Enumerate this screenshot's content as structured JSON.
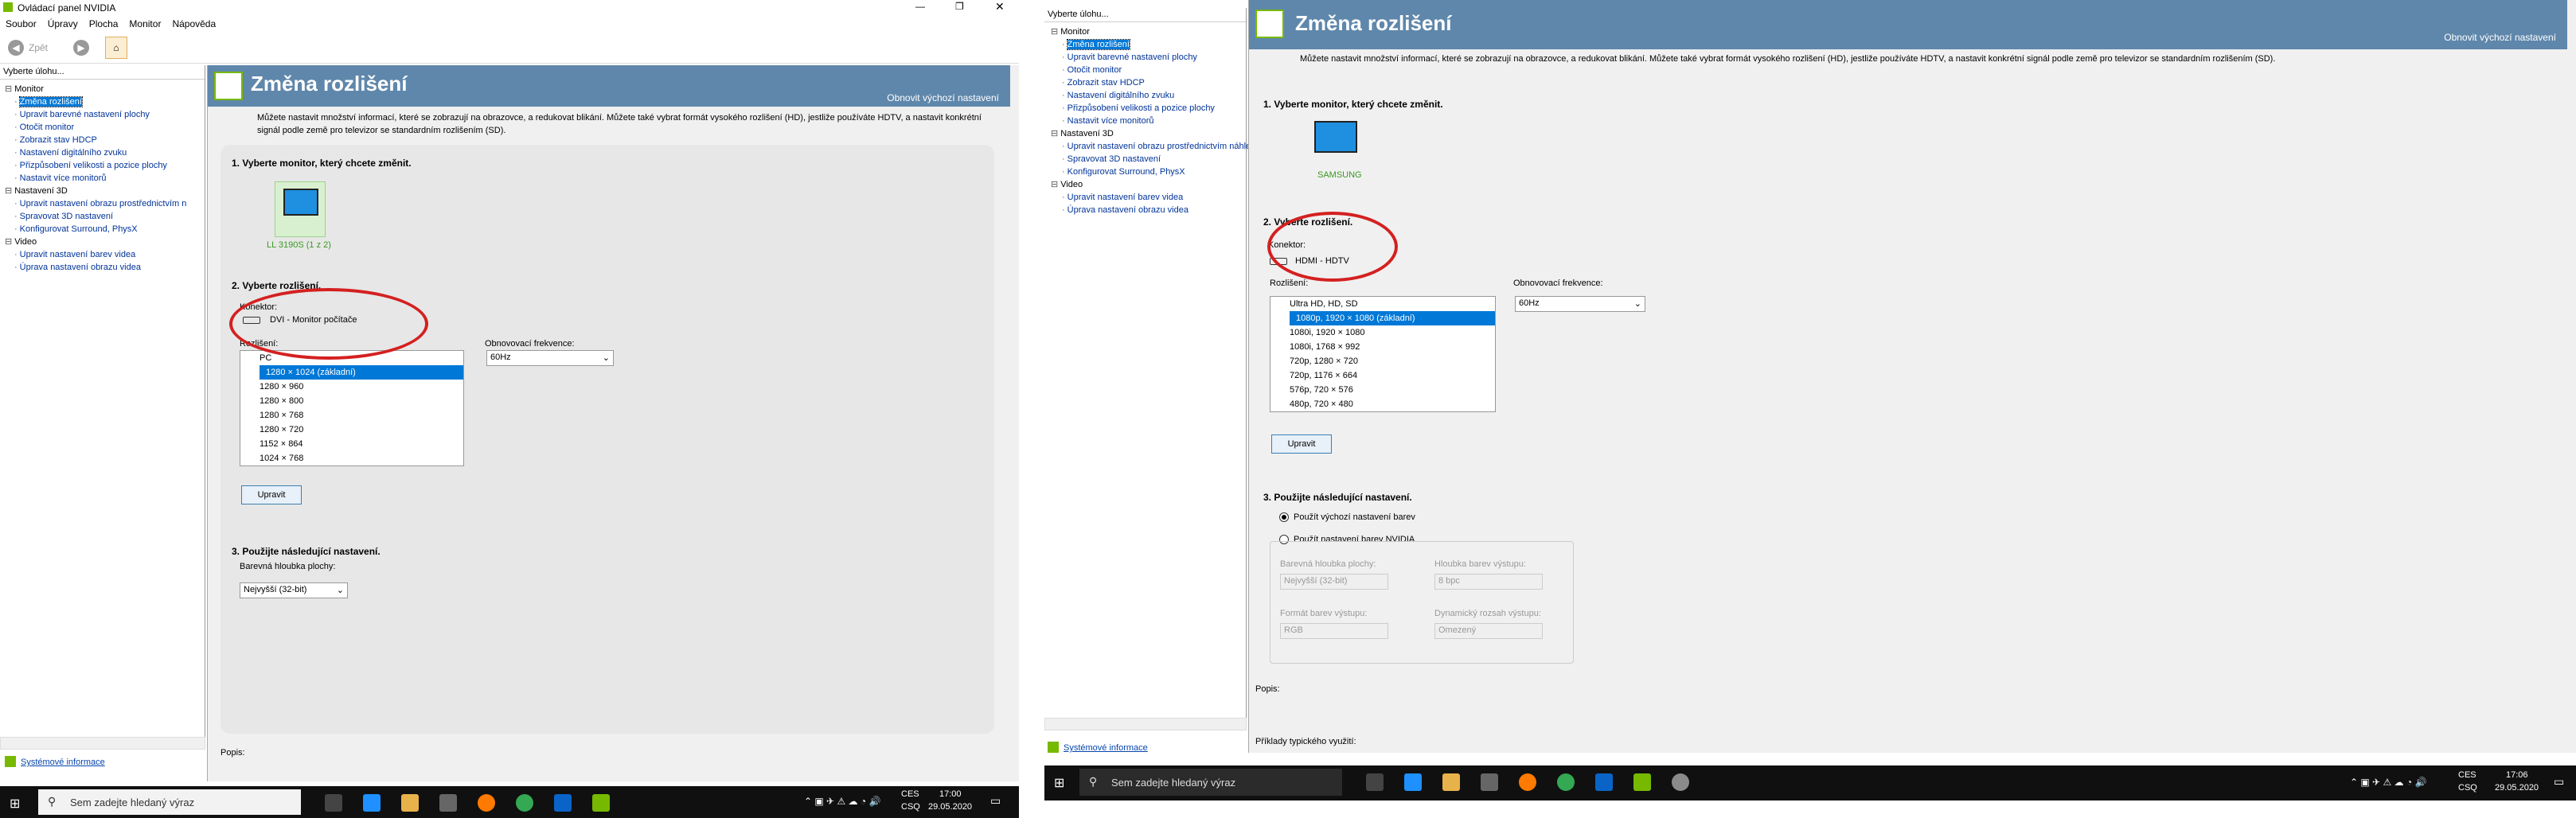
{
  "left": {
    "window_title": "Ovládací panel NVIDIA",
    "menu": [
      "Soubor",
      "Úpravy",
      "Plocha",
      "Monitor",
      "Nápověda"
    ],
    "back_label": "Zpět",
    "tree_head": "Vyberte úlohu...",
    "tree": [
      {
        "text": "Monitor",
        "level": 0
      },
      {
        "text": "Změna rozlišení",
        "level": 1,
        "selected": true
      },
      {
        "text": "Upravit barevné nastavení plochy",
        "level": 1
      },
      {
        "text": "Otočit monitor",
        "level": 1
      },
      {
        "text": "Zobrazit stav HDCP",
        "level": 1
      },
      {
        "text": "Nastavení digitálního zvuku",
        "level": 1
      },
      {
        "text": "Přizpůsobení velikosti a pozice plochy",
        "level": 1
      },
      {
        "text": "Nastavit více monitorů",
        "level": 1
      },
      {
        "text": "Nastavení 3D",
        "level": 0
      },
      {
        "text": "Upravit nastavení obrazu prostřednictvím n",
        "level": 1
      },
      {
        "text": "Spravovat 3D nastavení",
        "level": 1
      },
      {
        "text": "Konfigurovat Surround, PhysX",
        "level": 1
      },
      {
        "text": "Video",
        "level": 0
      },
      {
        "text": "Upravit nastavení barev videa",
        "level": 1
      },
      {
        "text": "Úprava nastavení obrazu videa",
        "level": 1
      }
    ],
    "page_title": "Změna rozlišení",
    "restore_defaults": "Obnovit výchozí nastavení",
    "description": "Můžete nastavit množství informací, které se zobrazují na obrazovce, a redukovat blikání. Můžete také vybrat formát vysokého rozlišení (HD), jestliže používáte HDTV, a nastavit konkrétní signál podle země pro televizor se standardním rozlišením (SD).",
    "step1": "1. Vyberte monitor, který chcete změnit.",
    "monitor_name": "LL 3190S (1 z 2)",
    "step2": "2. Vyberte rozlišení.",
    "connector_label": "Konektor:",
    "connector_value": "DVI - Monitor počítače",
    "resolution_label": "Rozlišení:",
    "refresh_label": "Obnovovací frekvence:",
    "refresh_value": "60Hz",
    "resolutions": [
      "PC",
      "1280 × 1024 (základní)",
      "1280 × 960",
      "1280 × 800",
      "1280 × 768",
      "1280 × 720",
      "1152 × 864",
      "1024 × 768"
    ],
    "customize_button": "Upravit",
    "step3": "3. Použijte následující nastavení.",
    "depth_label": "Barevná hloubka plochy:",
    "depth_value": "Nejvyšší (32-bit)",
    "popis_label": "Popis:",
    "system_info": "Systémové informace"
  },
  "right": {
    "tree_head": "Vyberte úlohu...",
    "tree": [
      {
        "text": "Monitor",
        "level": 0
      },
      {
        "text": "Změna rozlišení",
        "level": 1,
        "selected": true
      },
      {
        "text": "Upravit barevné nastavení plochy",
        "level": 1
      },
      {
        "text": "Otočit monitor",
        "level": 1
      },
      {
        "text": "Zobrazit stav HDCP",
        "level": 1
      },
      {
        "text": "Nastavení digitálního zvuku",
        "level": 1
      },
      {
        "text": "Přizpůsobení velikosti a pozice plochy",
        "level": 1
      },
      {
        "text": "Nastavit více monitorů",
        "level": 1
      },
      {
        "text": "Nastavení 3D",
        "level": 0
      },
      {
        "text": "Upravit nastavení obrazu prostřednictvím náhledu",
        "level": 1
      },
      {
        "text": "Spravovat 3D nastavení",
        "level": 1
      },
      {
        "text": "Konfigurovat Surround, PhysX",
        "level": 1
      },
      {
        "text": "Video",
        "level": 0
      },
      {
        "text": "Upravit nastavení barev videa",
        "level": 1
      },
      {
        "text": "Úprava nastavení obrazu videa",
        "level": 1
      }
    ],
    "page_title": "Změna rozlišení",
    "restore_defaults": "Obnovit výchozí nastavení",
    "description": "Můžete nastavit množství informací, které se zobrazují na obrazovce, a redukovat blikání. Můžete také vybrat formát vysokého rozlišení (HD), jestliže používáte HDTV, a nastavit konkrétní signál podle země pro televizor se standardním rozlišením (SD).",
    "step1": "1. Vyberte monitor, který chcete změnit.",
    "monitor_name": "SAMSUNG",
    "step2": "2. Vyberte rozlišení.",
    "connector_label": "Konektor:",
    "connector_value": "HDMI - HDTV",
    "resolution_label": "Rozlišení:",
    "refresh_label": "Obnovovací frekvence:",
    "refresh_value": "60Hz",
    "resolutions": [
      "Ultra HD, HD, SD",
      "1080p, 1920 × 1080 (základní)",
      "1080i, 1920 × 1080",
      "1080i, 1768 × 992",
      "720p, 1280 × 720",
      "720p, 1176 × 664",
      "576p, 720 × 576",
      "480p, 720 × 480"
    ],
    "customize_button": "Upravit",
    "step3": "3. Použijte následující nastavení.",
    "radio_default": "Použít výchozí nastavení barev",
    "radio_nvidia": "Použít nastavení barev NVIDIA",
    "desktop_depth_label": "Barevná hloubka plochy:",
    "desktop_depth_value": "Nejvyšší (32-bit)",
    "output_depth_label": "Hloubka barev výstupu:",
    "output_depth_value": "8 bpc",
    "output_format_label": "Formát barev výstupu:",
    "output_format_value": "RGB",
    "dynamic_range_label": "Dynamický rozsah výstupu:",
    "dynamic_range_value": "Omezený",
    "popis_label": "Popis:",
    "typical_label": "Příklady typického využití:",
    "system_info": "Systémové informace"
  },
  "taskbar_left": {
    "search_placeholder": "Sem zadejte hledaný výraz",
    "lang": "CES",
    "lang2": "CSQ",
    "time": "17:00",
    "date": "29.05.2020"
  },
  "taskbar_right": {
    "search_placeholder": "Sem zadejte hledaný výraz",
    "lang": "CES",
    "lang2": "CSQ",
    "time": "17:06",
    "date": "29.05.2020"
  },
  "colors": {
    "header": "#5f87ab",
    "selection": "#0078d7",
    "circle": "#d42020",
    "nvidia": "#76b900"
  }
}
